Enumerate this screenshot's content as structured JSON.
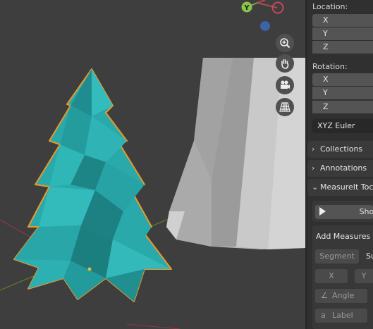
{
  "viewport": {
    "gizmo_y_label": "Y",
    "nav_icons": [
      "zoom-icon",
      "hand-pan-icon",
      "camera-icon",
      "perspective-grid-icon"
    ]
  },
  "sidebar": {
    "location_label": "Location:",
    "location_axes": [
      "X",
      "Y",
      "Z"
    ],
    "rotation_label": "Rotation:",
    "rotation_axes": [
      "X",
      "Y",
      "Z"
    ],
    "rotation_mode": "XYZ Euler",
    "collections_label": "Collections",
    "annotations_label": "Annotations",
    "measureit_label": "MeasureIt Toc",
    "show_button": "Show",
    "add_measures_label": "Add Measures",
    "segment_button": "Segment",
    "segment_side_text": "Su",
    "x_button": "X",
    "y_button": "Y",
    "angle_button": "Angle",
    "label_button": "Label"
  },
  "colors": {
    "tree": "#2aa9ab",
    "tree_outline": "#e89a2b",
    "cone": "#bdbdbd",
    "background": "#3e3e3e"
  }
}
